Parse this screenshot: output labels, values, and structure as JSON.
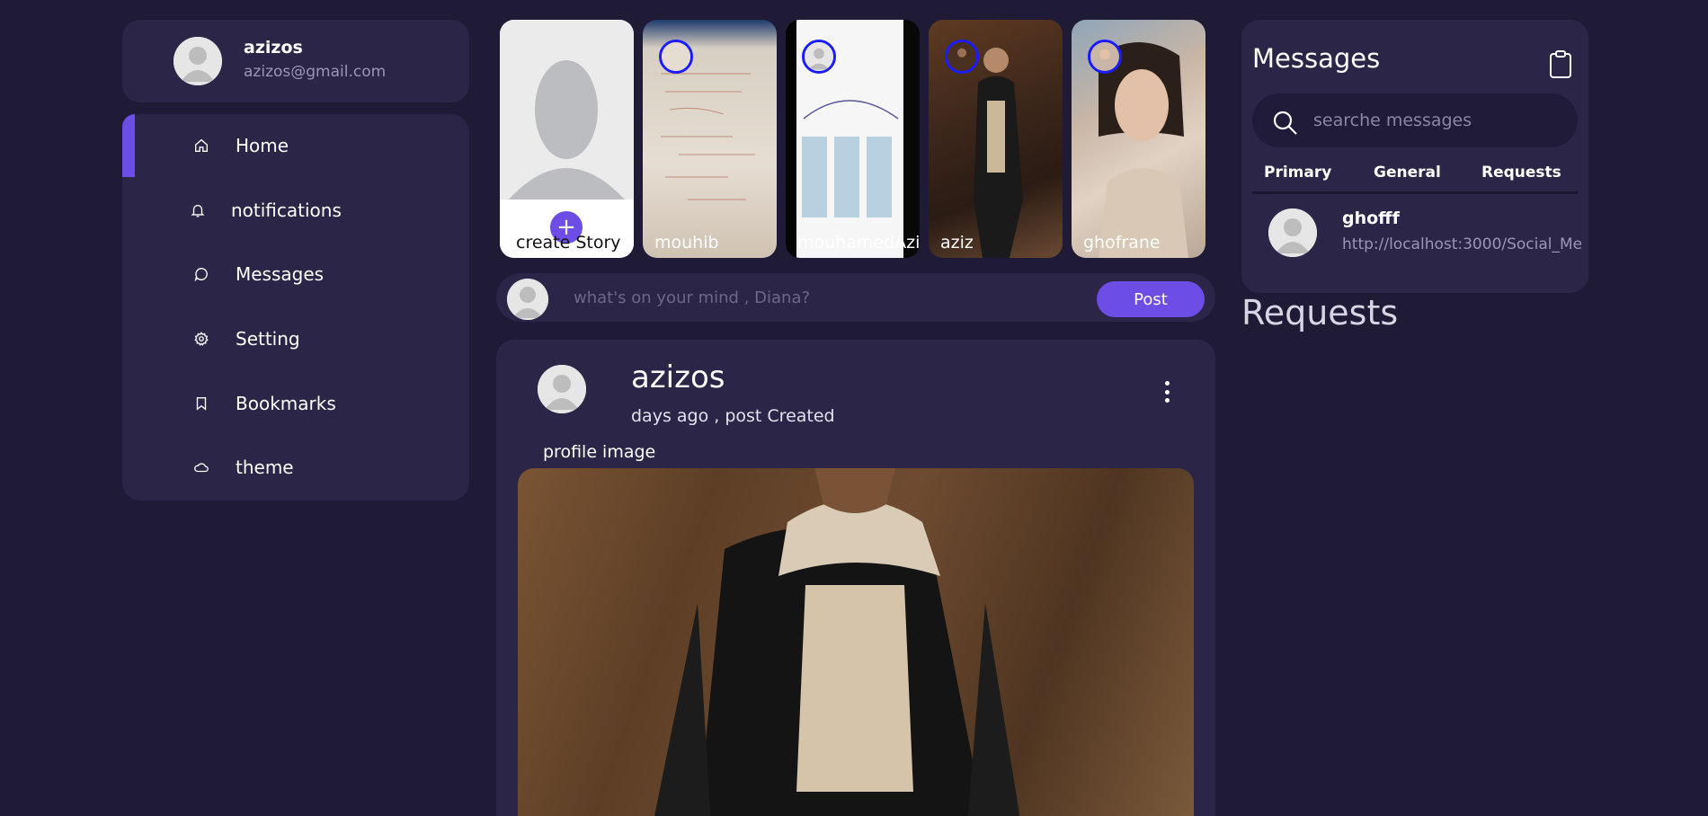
{
  "profile": {
    "name": "azizos",
    "email": "azizos@gmail.com"
  },
  "nav": {
    "items": [
      {
        "label": "Home",
        "icon": "home-icon",
        "active": true
      },
      {
        "label": "notifications",
        "icon": "bell-icon"
      },
      {
        "label": "Messages",
        "icon": "chat-bubble-icon"
      },
      {
        "label": "Setting",
        "icon": "gear-icon"
      },
      {
        "label": "Bookmarks",
        "icon": "bookmark-icon"
      },
      {
        "label": "theme",
        "icon": "cloud-icon"
      }
    ]
  },
  "stories": {
    "create_label": "create Story",
    "items": [
      {
        "name": "mouhib"
      },
      {
        "name": "mouhamedAzi:"
      },
      {
        "name": "aziz"
      },
      {
        "name": "ghofrane"
      }
    ]
  },
  "composer": {
    "placeholder": "what's on your mind , Diana?",
    "post_label": "Post"
  },
  "post": {
    "author": "azizos",
    "meta": "days ago , post Created",
    "caption": "profile image"
  },
  "messages": {
    "title": "Messages",
    "search_placeholder": "searche messages",
    "tabs": [
      "Primary",
      "General",
      "Requests"
    ],
    "items": [
      {
        "sender": "ghofff",
        "preview": "http://localhost:3000/Social_Me"
      }
    ]
  },
  "requests": {
    "heading": "Requests"
  },
  "colors": {
    "background": "#1f1a36",
    "panel": "#2b2548",
    "accent": "#6c4de6",
    "story_ring": "#1b1bff"
  }
}
